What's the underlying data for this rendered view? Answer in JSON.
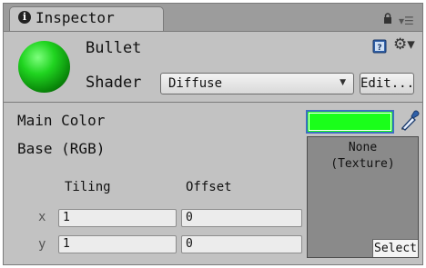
{
  "tab": {
    "title": "Inspector"
  },
  "object": {
    "name": "Bullet"
  },
  "shader": {
    "label": "Shader",
    "value": "Diffuse",
    "edit_label": "Edit..."
  },
  "properties": {
    "main_color": {
      "label": "Main Color",
      "color": "#1aff1a"
    },
    "base": {
      "label": "Base (RGB)",
      "texture_line1": "None",
      "texture_line2": "(Texture)",
      "select_label": "Select",
      "tiling_label": "Tiling",
      "offset_label": "Offset",
      "rows": [
        {
          "axis": "x",
          "tiling": "1",
          "offset": "0"
        },
        {
          "axis": "y",
          "tiling": "1",
          "offset": "0"
        }
      ]
    }
  },
  "icons": [
    "info-icon",
    "lock-icon",
    "menu-icon",
    "help-book-icon",
    "gear-icon",
    "dropdown-arrow-icon",
    "eyedropper-icon"
  ]
}
